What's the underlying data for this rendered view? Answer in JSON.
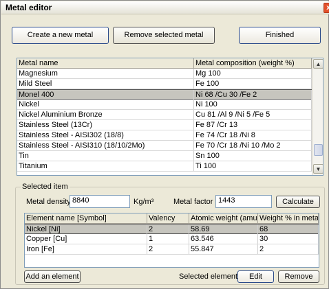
{
  "window": {
    "title": "Metal editor",
    "close_glyph": "x"
  },
  "toolbar": {
    "create_label": "Create a new metal",
    "remove_label": "Remove selected metal",
    "finished_label": "Finished"
  },
  "metals": {
    "columns": [
      "Metal name",
      "Metal composition (weight %)"
    ],
    "rows": [
      [
        "Magnesium",
        "Mg 100"
      ],
      [
        "Mild Steel",
        "Fe 100"
      ],
      [
        "Monel 400",
        "Ni 68 /Cu 30 /Fe 2"
      ],
      [
        "Nickel",
        "Ni 100"
      ],
      [
        "Nickel Aluminium Bronze",
        "Cu 81 /Al 9 /Ni 5 /Fe 5"
      ],
      [
        "Stainless Steel (13Cr)",
        "Fe 87 /Cr 13"
      ],
      [
        "Stainless Steel - AISI302 (18/8)",
        "Fe 74 /Cr 18 /Ni 8"
      ],
      [
        "Stainless Steel - AISI310 (18/10/2Mo)",
        "Fe 70 /Cr 18 /Ni 10 /Mo 2"
      ],
      [
        "Tin",
        "Sn 100"
      ],
      [
        "Titanium",
        "Ti 100"
      ]
    ],
    "selected_index": 2
  },
  "selected_item": {
    "group_label": "Selected item",
    "density_label": "Metal density",
    "density_value": "8840",
    "density_unit": "Kg/m³",
    "factor_label": "Metal factor",
    "factor_value": "1443",
    "calculate_label": "Calculate",
    "elements": {
      "columns": [
        "Element name [Symbol]",
        "Valency",
        "Atomic weight (amu)",
        "Weight % in metal"
      ],
      "rows": [
        [
          "Nickel [Ni]",
          "2",
          "58.69",
          "68"
        ],
        [
          "Copper [Cu]",
          "1",
          "63.546",
          "30"
        ],
        [
          "Iron [Fe]",
          "2",
          "55.847",
          "2"
        ]
      ],
      "selected_index": 0
    },
    "add_element_label": "Add an element",
    "selected_element_label": "Selected element",
    "edit_label": "Edit",
    "remove_label": "Remove"
  },
  "icons": {
    "scroll_up": "arrow-up-icon",
    "scroll_down": "arrow-down-icon",
    "close": "close-icon"
  }
}
